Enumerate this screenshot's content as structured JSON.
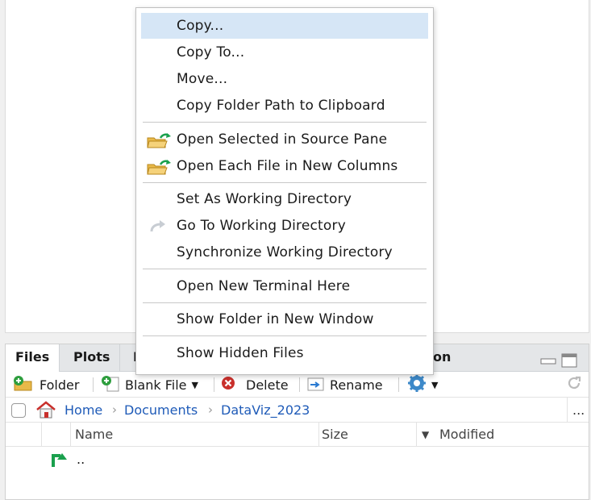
{
  "context_menu": {
    "items": [
      {
        "label": "Copy...",
        "selected": true
      },
      {
        "label": "Copy To..."
      },
      {
        "label": "Move..."
      },
      {
        "label": "Copy Folder Path to Clipboard"
      },
      {
        "label": "Open Selected in Source Pane",
        "icon": "folder-open-icon"
      },
      {
        "label": "Open Each File in New Columns",
        "icon": "folder-open-icon"
      },
      {
        "label": "Set As Working Directory"
      },
      {
        "label": "Go To Working Directory",
        "icon": "redo-arrow-icon"
      },
      {
        "label": "Synchronize Working Directory"
      },
      {
        "label": "Open New Terminal Here"
      },
      {
        "label": "Show Folder in New Window"
      },
      {
        "label": "Show Hidden Files"
      }
    ]
  },
  "files_pane": {
    "tabs": [
      "Files",
      "Plots",
      "I",
      "on"
    ],
    "toolbar": {
      "new_folder": "Folder",
      "blank_file": "Blank File",
      "delete": "Delete",
      "rename": "Rename"
    },
    "breadcrumb": [
      "Home",
      "Documents",
      "DataViz_2023"
    ],
    "more": "...",
    "columns": {
      "name": "Name",
      "size": "Size",
      "modified": "Modified"
    },
    "rows": [
      {
        "name": ".."
      }
    ]
  },
  "colors": {
    "accent": "#1f5bb8",
    "selection": "#d6e6f6",
    "green": "#2e9e3e",
    "red": "#c9302c"
  }
}
